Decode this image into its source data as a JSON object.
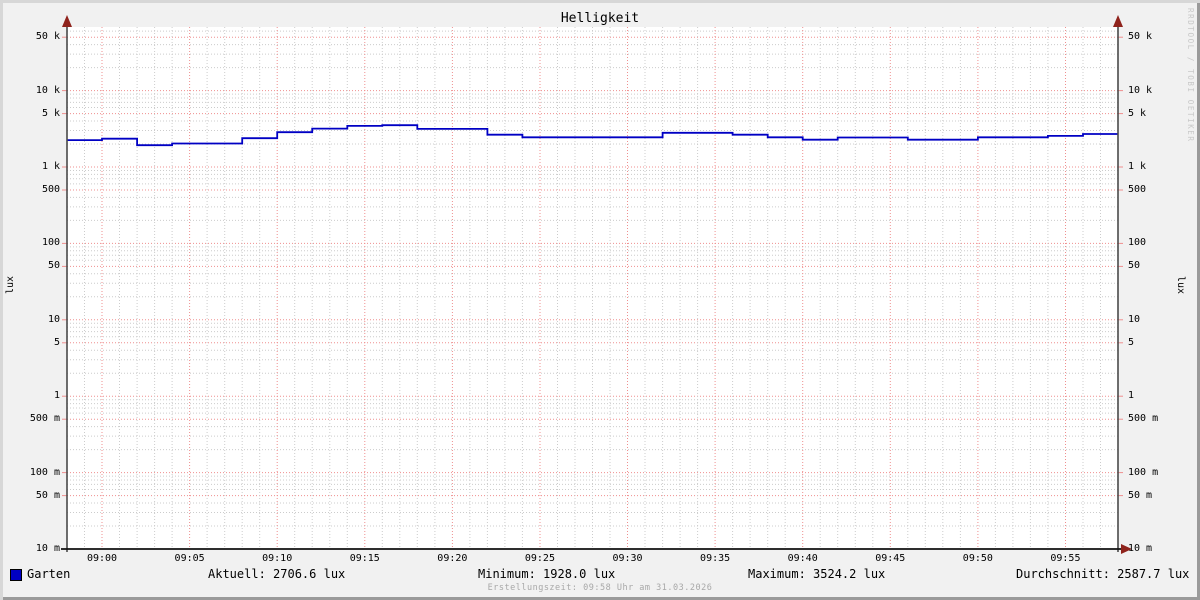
{
  "title": "Helligkeit",
  "watermark": "RRDTOOL / TOBI OETIKER",
  "y_axis": {
    "unit_left": "lux",
    "unit_right": "lux"
  },
  "legend": {
    "series_label": "Garten",
    "aktuell": "Aktuell: 2706.6 lux",
    "minimum": "Minimum: 1928.0 lux",
    "maximum": "Maximum: 3524.2 lux",
    "durchschnitt": "Durchschnitt: 2587.7 lux"
  },
  "footer": "Erstellungszeit: 09:58 Uhr am 31.03.2026",
  "colors": {
    "series": "#0000c4",
    "grid_major": "#ef8f8f",
    "grid_minor": "#cccccc",
    "axis": "#4a4a4a",
    "x_axis": "#111111",
    "arrow": "#8f231c",
    "plot_bg": "#ffffff",
    "image_bg": "#f1f1f1"
  },
  "chart_data": {
    "type": "line",
    "line_style": "step-after",
    "title": "Helligkeit",
    "xlabel": "",
    "ylabel": "lux",
    "y_scale": "log",
    "ylim": [
      0.01,
      60000
    ],
    "grid": true,
    "legend_position": "bottom",
    "x_range": [
      "08:58",
      "09:58"
    ],
    "x_major_ticks": [
      "09:00",
      "09:05",
      "09:10",
      "09:15",
      "09:20",
      "09:25",
      "09:30",
      "09:35",
      "09:40",
      "09:45",
      "09:50",
      "09:55"
    ],
    "y_major_ticks": [
      {
        "label": "50 k",
        "value": 50000
      },
      {
        "label": "10 k",
        "value": 10000
      },
      {
        "label": "5 k",
        "value": 5000
      },
      {
        "label": "1 k",
        "value": 1000
      },
      {
        "label": "500",
        "value": 500
      },
      {
        "label": "100",
        "value": 100
      },
      {
        "label": "50",
        "value": 50
      },
      {
        "label": "10",
        "value": 10
      },
      {
        "label": "5",
        "value": 5
      },
      {
        "label": "1",
        "value": 1
      },
      {
        "label": "500 m",
        "value": 0.5
      },
      {
        "label": "100 m",
        "value": 0.1
      },
      {
        "label": "50 m",
        "value": 0.05
      },
      {
        "label": "10 m",
        "value": 0.01
      }
    ],
    "series": [
      {
        "name": "Garten",
        "color": "#0000c4",
        "unit": "lux",
        "points": [
          [
            "08:58",
            2250
          ],
          [
            "09:00",
            2350
          ],
          [
            "09:02",
            1930
          ],
          [
            "09:04",
            2030
          ],
          [
            "09:06",
            2030
          ],
          [
            "09:08",
            2380
          ],
          [
            "09:10",
            2850
          ],
          [
            "09:12",
            3180
          ],
          [
            "09:14",
            3450
          ],
          [
            "09:16",
            3524
          ],
          [
            "09:18",
            3150
          ],
          [
            "09:20",
            3150
          ],
          [
            "09:22",
            2650
          ],
          [
            "09:24",
            2450
          ],
          [
            "09:26",
            2450
          ],
          [
            "09:28",
            2450
          ],
          [
            "09:30",
            2450
          ],
          [
            "09:32",
            2800
          ],
          [
            "09:34",
            2800
          ],
          [
            "09:36",
            2650
          ],
          [
            "09:38",
            2450
          ],
          [
            "09:40",
            2280
          ],
          [
            "09:42",
            2430
          ],
          [
            "09:44",
            2430
          ],
          [
            "09:46",
            2280
          ],
          [
            "09:48",
            2280
          ],
          [
            "09:50",
            2450
          ],
          [
            "09:52",
            2450
          ],
          [
            "09:54",
            2550
          ],
          [
            "09:56",
            2707
          ]
        ]
      }
    ],
    "stats": {
      "aktuell_lux": 2706.6,
      "minimum_lux": 1928.0,
      "maximum_lux": 3524.2,
      "durchschnitt_lux": 2587.7
    }
  }
}
